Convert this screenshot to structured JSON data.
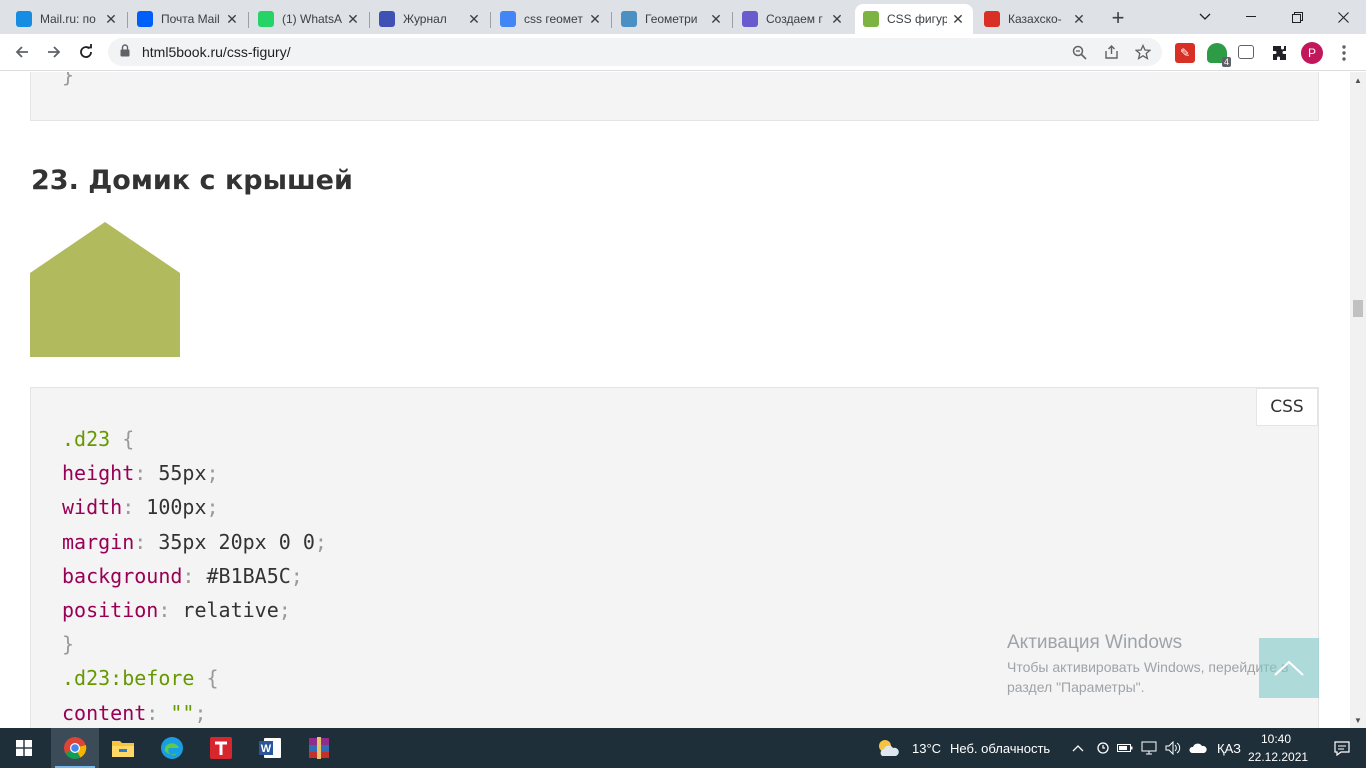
{
  "tabs": [
    {
      "title": "Mail.ru: по",
      "favicon": "mailru-icon",
      "color": "#168de2"
    },
    {
      "title": "Почта Mail",
      "favicon": "mail-envelope-icon",
      "color": "#005ff9"
    },
    {
      "title": "(1) WhatsA",
      "favicon": "whatsapp-icon",
      "color": "#25d366"
    },
    {
      "title": "Журнал",
      "favicon": "journal-icon",
      "color": "#3f51b5"
    },
    {
      "title": "css геомет",
      "favicon": "google-icon",
      "color": "#4285f4"
    },
    {
      "title": "Геометри",
      "favicon": "geometry-icon",
      "color": "#4a90c2"
    },
    {
      "title": "Создаем г",
      "favicon": "create-icon",
      "color": "#6a5acd"
    },
    {
      "title": "CSS фигур",
      "favicon": "html5book-icon",
      "color": "#7cb342"
    },
    {
      "title": "Казахско-",
      "favicon": "translate-icon",
      "color": "#d93025"
    }
  ],
  "active_tab": 7,
  "address": {
    "url": "html5book.ru/css-figury/"
  },
  "profile_initial": "P",
  "ext_badge": "4",
  "page": {
    "heading": "23. Домик с крышей",
    "house_color": "#B1BA5C",
    "code_lang": "CSS",
    "code_lines": [
      [
        {
          "t": ".d23",
          "c": "sel"
        },
        {
          "t": " {",
          "c": "pun"
        }
      ],
      [
        {
          "t": "height",
          "c": "prop"
        },
        {
          "t": ":",
          "c": "pun"
        },
        {
          "t": " 55px",
          "c": "val"
        },
        {
          "t": ";",
          "c": "pun"
        }
      ],
      [
        {
          "t": "width",
          "c": "prop"
        },
        {
          "t": ":",
          "c": "pun"
        },
        {
          "t": " 100px",
          "c": "val"
        },
        {
          "t": ";",
          "c": "pun"
        }
      ],
      [
        {
          "t": "margin",
          "c": "prop"
        },
        {
          "t": ":",
          "c": "pun"
        },
        {
          "t": " 35px 20px 0 0",
          "c": "val"
        },
        {
          "t": ";",
          "c": "pun"
        }
      ],
      [
        {
          "t": "background",
          "c": "prop"
        },
        {
          "t": ":",
          "c": "pun"
        },
        {
          "t": " #B1BA5C",
          "c": "val"
        },
        {
          "t": ";",
          "c": "pun"
        }
      ],
      [
        {
          "t": "position",
          "c": "prop"
        },
        {
          "t": ":",
          "c": "pun"
        },
        {
          "t": " relative",
          "c": "val"
        },
        {
          "t": ";",
          "c": "pun"
        }
      ],
      [
        {
          "t": "}",
          "c": "pun"
        }
      ],
      [
        {
          "t": ".d23:before",
          "c": "sel"
        },
        {
          "t": " {",
          "c": "pun"
        }
      ],
      [
        {
          "t": "content",
          "c": "prop"
        },
        {
          "t": ":",
          "c": "pun"
        },
        {
          "t": " \"\"",
          "c": "str"
        },
        {
          "t": ";",
          "c": "pun"
        }
      ]
    ],
    "prev_code_tail": "}"
  },
  "activation": {
    "title": "Активация Windows",
    "line1": "Чтобы активировать Windows, перейдите в",
    "line2": "раздел \"Параметры\"."
  },
  "taskbar": {
    "weather_temp": "13°C",
    "weather_text": "Неб. облачность",
    "lang": "ҚАЗ",
    "time": "10:40",
    "date": "22.12.2021"
  }
}
